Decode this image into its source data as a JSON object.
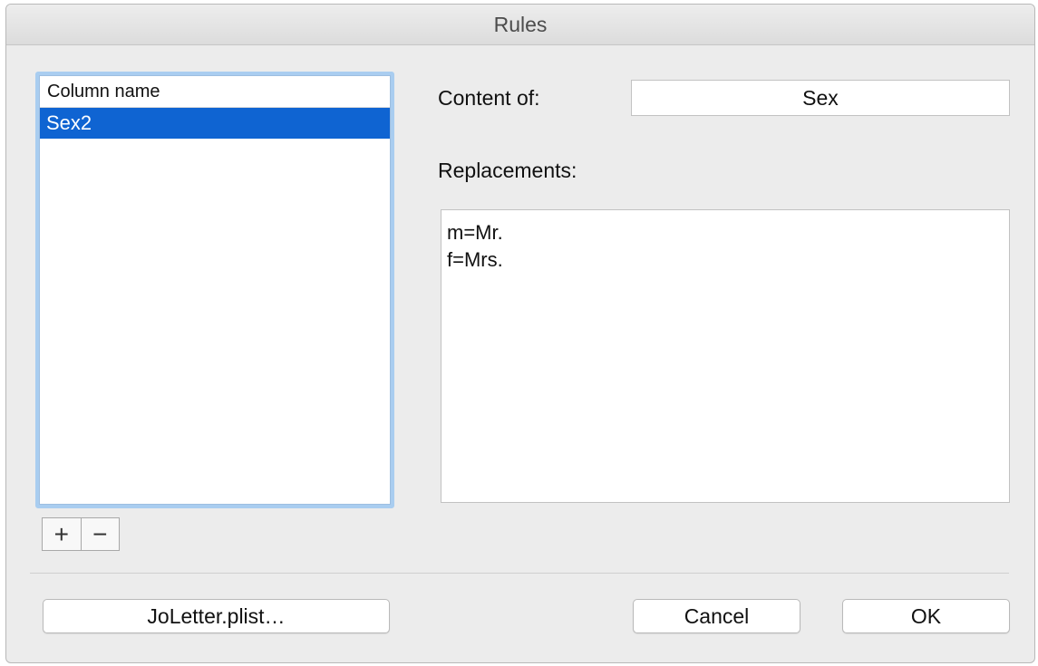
{
  "window": {
    "title": "Rules"
  },
  "list": {
    "column_header": "Column name",
    "rows": [
      "Sex2"
    ],
    "selected_index": 0,
    "add_symbol": "+",
    "remove_symbol": "−"
  },
  "form": {
    "content_label": "Content of:",
    "content_value": "Sex",
    "replacements_label": "Replacements:",
    "replacements_lines": [
      "m=Mr.",
      "f=Mrs."
    ]
  },
  "buttons": {
    "plist_label": "JoLetter.plist…",
    "cancel_label": "Cancel",
    "ok_label": "OK"
  },
  "colors": {
    "selection": "#0f64d2",
    "focus_ring": "#a9cdf0",
    "window_bg": "#ececec"
  }
}
